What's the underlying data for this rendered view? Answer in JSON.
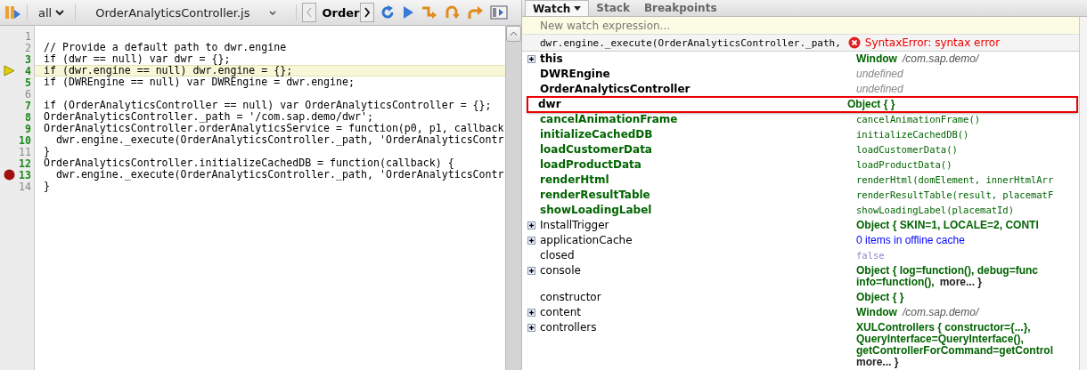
{
  "toolbar": {
    "filter": "all",
    "file": "OrderAnalyticsController.js",
    "breadcrumb": "Order"
  },
  "editor": {
    "lines": [
      {
        "number": "1",
        "executable": false,
        "current": false,
        "breakpoint": false
      },
      {
        "number": "2",
        "text": "// Provide a default path to dwr.engine",
        "executable": false,
        "current": false,
        "breakpoint": false
      },
      {
        "number": "3",
        "text": "if (dwr == null) var dwr = {};",
        "executable": true,
        "current": false,
        "breakpoint": false
      },
      {
        "number": "4",
        "text": "if (dwr.engine == null) dwr.engine = {};",
        "executable": true,
        "current": true,
        "breakpoint": false
      },
      {
        "number": "5",
        "text": "if (DWREngine == null) var DWREngine = dwr.engine;",
        "executable": true,
        "current": false,
        "breakpoint": false
      },
      {
        "number": "6",
        "executable": false,
        "current": false,
        "breakpoint": false
      },
      {
        "number": "7",
        "text": "if (OrderAnalyticsController == null) var OrderAnalyticsController = {};",
        "executable": true,
        "current": false,
        "breakpoint": false
      },
      {
        "number": "8",
        "text": "OrderAnalyticsController._path = '/com.sap.demo/dwr';",
        "executable": true,
        "current": false,
        "breakpoint": false
      },
      {
        "number": "9",
        "text": "OrderAnalyticsController.orderAnalyticsService = function(p0, p1, callback",
        "executable": true,
        "current": false,
        "breakpoint": false
      },
      {
        "number": "10",
        "text": "  dwr.engine._execute(OrderAnalyticsController._path, 'OrderAnalyticsContr",
        "executable": true,
        "current": false,
        "breakpoint": false
      },
      {
        "number": "11",
        "text": "}",
        "executable": false,
        "current": false,
        "breakpoint": false
      },
      {
        "number": "12",
        "text": "OrderAnalyticsController.initializeCachedDB = function(callback) {",
        "executable": true,
        "current": false,
        "breakpoint": false
      },
      {
        "number": "13",
        "text": "  dwr.engine._execute(OrderAnalyticsController._path, 'OrderAnalyticsContr",
        "executable": true,
        "current": false,
        "breakpoint": true
      },
      {
        "number": "14",
        "text": "}",
        "executable": false,
        "current": false,
        "breakpoint": false
      }
    ]
  },
  "tabs": [
    {
      "label": "Watch",
      "selected": true,
      "dropdown": true
    },
    {
      "label": "Stack",
      "selected": false,
      "dropdown": false
    },
    {
      "label": "Breakpoints",
      "selected": false,
      "dropdown": false
    }
  ],
  "watch": {
    "placeholder": "New watch expression...",
    "expression": "dwr.engine._execute(OrderAnalyticsController._path,",
    "error": "SyntaxError: syntax error",
    "rows": [
      {
        "name": "this",
        "kind": "local",
        "expandable": true,
        "highlighted": false,
        "value": [
          [
            {
              "text": "Window",
              "kind": "object"
            },
            {
              "text": "/com.sap.demo/",
              "kind": "path"
            }
          ]
        ]
      },
      {
        "name": "DWREngine",
        "kind": "local",
        "expandable": false,
        "highlighted": false,
        "value": [
          [
            {
              "text": "undefined",
              "kind": "undefined"
            }
          ]
        ]
      },
      {
        "name": "OrderAnalyticsController",
        "kind": "local",
        "expandable": false,
        "highlighted": false,
        "value": [
          [
            {
              "text": "undefined",
              "kind": "undefined"
            }
          ]
        ]
      },
      {
        "name": "dwr",
        "kind": "local",
        "expandable": false,
        "highlighted": true,
        "value": [
          [
            {
              "text": "Object {  }",
              "kind": "object"
            }
          ]
        ]
      },
      {
        "name": "cancelAnimationFrame",
        "kind": "function",
        "expandable": false,
        "highlighted": false,
        "value": [
          [
            {
              "text": "cancelAnimationFrame()",
              "kind": "function"
            }
          ]
        ]
      },
      {
        "name": "initializeCachedDB",
        "kind": "function",
        "expandable": false,
        "highlighted": false,
        "value": [
          [
            {
              "text": "initializeCachedDB()",
              "kind": "function"
            }
          ]
        ]
      },
      {
        "name": "loadCustomerData",
        "kind": "function",
        "expandable": false,
        "highlighted": false,
        "value": [
          [
            {
              "text": "loadCustomerData()",
              "kind": "function"
            }
          ]
        ]
      },
      {
        "name": "loadProductData",
        "kind": "function",
        "expandable": false,
        "highlighted": false,
        "value": [
          [
            {
              "text": "loadProductData()",
              "kind": "function"
            }
          ]
        ]
      },
      {
        "name": "renderHtml",
        "kind": "function",
        "expandable": false,
        "highlighted": false,
        "value": [
          [
            {
              "text": "renderHtml(domElement, innerHtmlArr",
              "kind": "function"
            }
          ]
        ]
      },
      {
        "name": "renderResultTable",
        "kind": "function",
        "expandable": false,
        "highlighted": false,
        "value": [
          [
            {
              "text": "renderResultTable(result, placematF",
              "kind": "function"
            }
          ]
        ]
      },
      {
        "name": "showLoadingLabel",
        "kind": "function",
        "expandable": false,
        "highlighted": false,
        "value": [
          [
            {
              "text": "showLoadingLabel(placematId)",
              "kind": "function"
            }
          ]
        ]
      },
      {
        "name": "InstallTrigger",
        "kind": "property",
        "expandable": true,
        "highlighted": false,
        "value": [
          [
            {
              "text": "Object { SKIN=1,  LOCALE=2,  CONTI",
              "kind": "object"
            }
          ]
        ]
      },
      {
        "name": "applicationCache",
        "kind": "property",
        "expandable": true,
        "highlighted": false,
        "value": [
          [
            {
              "text": "0 items in offline cache",
              "kind": "link"
            }
          ]
        ]
      },
      {
        "name": "closed",
        "kind": "property",
        "expandable": false,
        "highlighted": false,
        "value": [
          [
            {
              "text": "false",
              "kind": "boolean"
            }
          ]
        ]
      },
      {
        "name": "console",
        "kind": "property",
        "expandable": true,
        "highlighted": false,
        "value": [
          [
            {
              "text": "Object { log=function(),  debug=func",
              "kind": "object"
            }
          ],
          [
            {
              "text": "info=function(),",
              "kind": "object"
            },
            {
              "text": "more... }",
              "kind": "more"
            }
          ]
        ]
      },
      {
        "name": "constructor",
        "kind": "property",
        "expandable": false,
        "highlighted": false,
        "value": [
          [
            {
              "text": "Object {  }",
              "kind": "object"
            }
          ]
        ]
      },
      {
        "name": "content",
        "kind": "property",
        "expandable": true,
        "highlighted": false,
        "value": [
          [
            {
              "text": "Window",
              "kind": "object"
            },
            {
              "text": "/com.sap.demo/",
              "kind": "path"
            }
          ]
        ]
      },
      {
        "name": "controllers",
        "kind": "property",
        "expandable": true,
        "highlighted": false,
        "value": [
          [
            {
              "text": "XULControllers {  constructor={...},",
              "kind": "object"
            }
          ],
          [
            {
              "text": "QueryInterface=QueryInterface(),",
              "kind": "object"
            }
          ],
          [
            {
              "text": "getControllerForCommand=getControl",
              "kind": "object"
            }
          ],
          [
            {
              "text": "more... }",
              "kind": "more"
            }
          ]
        ]
      }
    ]
  }
}
